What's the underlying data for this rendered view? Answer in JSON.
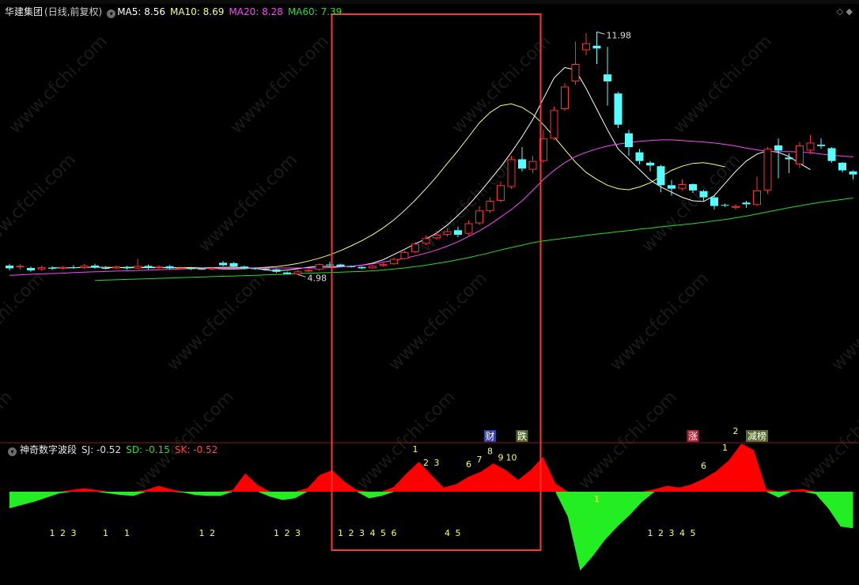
{
  "main": {
    "stock_name": "华建集团",
    "mode": "(日线,前复权)",
    "ma_labels": [
      {
        "text": "MA5: 8.56",
        "color": "#ffffff"
      },
      {
        "text": "MA10: 8.69",
        "color": "#ffff66"
      },
      {
        "text": "MA20: 8.28",
        "color": "#ff44ff"
      },
      {
        "text": "MA60: 7.39",
        "color": "#22dd22"
      }
    ],
    "high_label": "11.98",
    "low_label": "4.98",
    "event_tags": [
      {
        "text": "财",
        "bg": "#3340aa",
        "fg": "#ffffff"
      },
      {
        "text": "跌",
        "bg": "#556b2f",
        "fg": "#ffffff"
      },
      {
        "text": "涨",
        "bg": "#aa2233",
        "fg": "#ffffff"
      },
      {
        "text": "减榜",
        "bg": "#556b2f",
        "fg": "#ffffff"
      }
    ]
  },
  "sub": {
    "indicator_name": "神奇数字波段",
    "values": [
      {
        "text": "SJ: -0.52",
        "color": "#dddddd"
      },
      {
        "text": "SD: -0.15",
        "color": "#22dd22"
      },
      {
        "text": "SK: -0.52",
        "color": "#ff4444"
      }
    ]
  },
  "watermark": "www.cfchi.com",
  "colors": {
    "up": "#ff3030",
    "down": "#55ffff",
    "box": "#ff3333",
    "wave_pos": "#ff0000",
    "wave_neg": "#22ee22",
    "count": "#ffff44"
  },
  "chart_data": {
    "type": "candlestick",
    "title": "华建集团",
    "ylim": [
      4.6,
      12.3
    ],
    "candles": [
      {
        "o": 5.23,
        "c": 5.15,
        "h": 5.28,
        "l": 5.09
      },
      {
        "o": 5.18,
        "c": 5.22,
        "h": 5.27,
        "l": 5.12
      },
      {
        "o": 5.16,
        "c": 5.09,
        "h": 5.2,
        "l": 5.05
      },
      {
        "o": 5.12,
        "c": 5.18,
        "h": 5.22,
        "l": 5.08
      },
      {
        "o": 5.17,
        "c": 5.14,
        "h": 5.21,
        "l": 5.1
      },
      {
        "o": 5.14,
        "c": 5.19,
        "h": 5.22,
        "l": 5.11
      },
      {
        "o": 5.18,
        "c": 5.16,
        "h": 5.24,
        "l": 5.13
      },
      {
        "o": 5.16,
        "c": 5.23,
        "h": 5.27,
        "l": 5.13
      },
      {
        "o": 5.23,
        "c": 5.17,
        "h": 5.28,
        "l": 5.14
      },
      {
        "o": 5.16,
        "c": 5.15,
        "h": 5.21,
        "l": 5.12
      },
      {
        "o": 5.15,
        "c": 5.2,
        "h": 5.23,
        "l": 5.12
      },
      {
        "o": 5.19,
        "c": 5.15,
        "h": 5.22,
        "l": 5.11
      },
      {
        "o": 5.15,
        "c": 5.22,
        "h": 5.42,
        "l": 5.13
      },
      {
        "o": 5.22,
        "c": 5.16,
        "h": 5.26,
        "l": 5.12
      },
      {
        "o": 5.16,
        "c": 5.2,
        "h": 5.24,
        "l": 5.13
      },
      {
        "o": 5.21,
        "c": 5.15,
        "h": 5.24,
        "l": 5.12
      },
      {
        "o": 5.15,
        "c": 5.17,
        "h": 5.21,
        "l": 5.12
      },
      {
        "o": 5.16,
        "c": 5.13,
        "h": 5.19,
        "l": 5.1
      },
      {
        "o": 5.14,
        "c": 5.12,
        "h": 5.17,
        "l": 5.1
      },
      {
        "o": 5.12,
        "c": 5.16,
        "h": 5.19,
        "l": 5.1
      },
      {
        "o": 5.31,
        "c": 5.24,
        "h": 5.36,
        "l": 5.21
      },
      {
        "o": 5.3,
        "c": 5.2,
        "h": 5.33,
        "l": 5.18
      },
      {
        "o": 5.2,
        "c": 5.15,
        "h": 5.23,
        "l": 5.12
      },
      {
        "o": 5.15,
        "c": 5.13,
        "h": 5.18,
        "l": 5.11
      },
      {
        "o": 5.14,
        "c": 5.12,
        "h": 5.16,
        "l": 5.11
      },
      {
        "o": 5.12,
        "c": 5.05,
        "h": 5.14,
        "l": 5.02
      },
      {
        "o": 5.03,
        "c": 4.99,
        "h": 5.06,
        "l": 4.98
      },
      {
        "o": 4.98,
        "c": 5.06,
        "h": 5.1,
        "l": 4.97
      },
      {
        "o": 5.06,
        "c": 5.1,
        "h": 5.13,
        "l": 5.04
      },
      {
        "o": 5.11,
        "c": 5.27,
        "h": 5.29,
        "l": 5.08
      },
      {
        "o": 5.26,
        "c": 5.25,
        "h": 5.34,
        "l": 5.22
      },
      {
        "o": 5.26,
        "c": 5.21,
        "h": 5.28,
        "l": 5.19
      },
      {
        "o": 5.21,
        "c": 5.19,
        "h": 5.23,
        "l": 5.17
      },
      {
        "o": 5.19,
        "c": 5.15,
        "h": 5.21,
        "l": 5.13
      },
      {
        "o": 5.15,
        "c": 5.22,
        "h": 5.25,
        "l": 5.13
      },
      {
        "o": 5.22,
        "c": 5.27,
        "h": 5.3,
        "l": 5.2
      },
      {
        "o": 5.27,
        "c": 5.42,
        "h": 5.46,
        "l": 5.25
      },
      {
        "o": 5.42,
        "c": 5.62,
        "h": 5.66,
        "l": 5.4
      },
      {
        "o": 5.62,
        "c": 5.86,
        "h": 5.91,
        "l": 5.58
      },
      {
        "o": 5.86,
        "c": 6.02,
        "h": 6.1,
        "l": 5.82
      },
      {
        "o": 6.02,
        "c": 6.12,
        "h": 6.22,
        "l": 5.97
      },
      {
        "o": 6.12,
        "c": 6.22,
        "h": 6.3,
        "l": 6.07
      },
      {
        "o": 6.25,
        "c": 6.12,
        "h": 6.35,
        "l": 6.05
      },
      {
        "o": 6.15,
        "c": 6.45,
        "h": 6.53,
        "l": 6.1
      },
      {
        "o": 6.45,
        "c": 6.82,
        "h": 6.95,
        "l": 6.4
      },
      {
        "o": 6.8,
        "c": 7.1,
        "h": 7.2,
        "l": 6.75
      },
      {
        "o": 7.1,
        "c": 7.55,
        "h": 7.66,
        "l": 7.05
      },
      {
        "o": 7.5,
        "c": 8.3,
        "h": 8.4,
        "l": 7.45
      },
      {
        "o": 8.3,
        "c": 8.03,
        "h": 8.65,
        "l": 7.95
      },
      {
        "o": 8.0,
        "c": 8.25,
        "h": 8.4,
        "l": 7.9
      },
      {
        "o": 8.25,
        "c": 8.9,
        "h": 9.15,
        "l": 8.2
      },
      {
        "o": 8.9,
        "c": 9.72,
        "h": 9.82,
        "l": 8.85
      },
      {
        "o": 9.75,
        "c": 10.4,
        "h": 10.5,
        "l": 9.7
      },
      {
        "o": 10.55,
        "c": 11.05,
        "h": 11.7,
        "l": 10.45
      },
      {
        "o": 11.45,
        "c": 11.65,
        "h": 11.95,
        "l": 11.3
      },
      {
        "o": 11.58,
        "c": 11.5,
        "h": 11.98,
        "l": 11.05
      },
      {
        "o": 10.75,
        "c": 10.55,
        "h": 11.55,
        "l": 9.85
      },
      {
        "o": 10.2,
        "c": 9.3,
        "h": 10.25,
        "l": 9.2
      },
      {
        "o": 9.05,
        "c": 8.65,
        "h": 9.15,
        "l": 8.4
      },
      {
        "o": 8.5,
        "c": 8.25,
        "h": 8.6,
        "l": 8.15
      },
      {
        "o": 8.2,
        "c": 8.12,
        "h": 8.25,
        "l": 7.95
      },
      {
        "o": 8.1,
        "c": 7.55,
        "h": 8.14,
        "l": 7.35
      },
      {
        "o": 7.55,
        "c": 7.45,
        "h": 7.7,
        "l": 7.25
      },
      {
        "o": 7.45,
        "c": 7.58,
        "h": 7.72,
        "l": 7.4
      },
      {
        "o": 7.58,
        "c": 7.4,
        "h": 7.6,
        "l": 7.33
      },
      {
        "o": 7.38,
        "c": 7.2,
        "h": 7.42,
        "l": 7.1
      },
      {
        "o": 7.2,
        "c": 6.95,
        "h": 7.25,
        "l": 6.85
      },
      {
        "o": 6.98,
        "c": 6.97,
        "h": 7.02,
        "l": 6.92
      },
      {
        "o": 6.9,
        "c": 6.95,
        "h": 7.0,
        "l": 6.85
      },
      {
        "o": 7.05,
        "c": 7.0,
        "h": 7.1,
        "l": 6.9
      },
      {
        "o": 6.98,
        "c": 7.4,
        "h": 7.8,
        "l": 6.95
      },
      {
        "o": 7.4,
        "c": 8.6,
        "h": 8.65,
        "l": 7.3
      },
      {
        "o": 8.7,
        "c": 8.55,
        "h": 8.9,
        "l": 7.75
      },
      {
        "o": 8.35,
        "c": 8.3,
        "h": 8.48,
        "l": 7.9
      },
      {
        "o": 8.15,
        "c": 8.7,
        "h": 8.8,
        "l": 8.05
      },
      {
        "o": 8.55,
        "c": 8.78,
        "h": 9.0,
        "l": 8.45
      },
      {
        "o": 8.72,
        "c": 8.68,
        "h": 8.9,
        "l": 8.6
      },
      {
        "o": 8.62,
        "c": 8.25,
        "h": 8.65,
        "l": 8.2
      },
      {
        "o": 8.2,
        "c": 7.98,
        "h": 8.22,
        "l": 7.92
      },
      {
        "o": 7.95,
        "c": 7.86,
        "h": 7.98,
        "l": 7.72
      }
    ],
    "ma_series": [
      {
        "name": "MA5",
        "color": "#ffffff",
        "start": 4,
        "values": [
          5.17,
          5.16,
          5.17,
          5.18,
          5.18,
          5.18,
          5.17,
          5.18,
          5.18,
          5.18,
          5.18,
          5.17,
          5.17,
          5.17,
          5.16,
          5.17,
          5.18,
          5.18,
          5.17,
          5.15,
          5.1,
          5.08,
          5.1,
          5.14,
          5.18,
          5.21,
          5.2,
          5.2,
          5.21,
          5.24,
          5.3,
          5.4,
          5.55,
          5.7,
          5.86,
          6.0,
          6.17,
          6.4,
          6.68,
          6.98,
          7.33,
          7.7,
          8.08,
          8.5,
          8.95,
          9.45,
          10.05,
          10.65,
          10.95,
          10.88,
          10.35,
          9.75,
          9.15,
          8.6,
          8.3,
          8.0,
          7.7,
          7.5,
          7.35,
          7.2,
          7.1,
          7.08,
          7.25,
          7.6,
          7.95,
          8.25,
          8.45,
          8.55,
          8.5,
          8.38,
          8.18,
          8.0
        ]
      },
      {
        "name": "MA10",
        "color": "#ffff66",
        "start": 9,
        "values": [
          5.18,
          5.17,
          5.17,
          5.17,
          5.17,
          5.17,
          5.17,
          5.17,
          5.17,
          5.16,
          5.15,
          5.13,
          5.13,
          5.14,
          5.16,
          5.18,
          5.2,
          5.24,
          5.29,
          5.36,
          5.44,
          5.54,
          5.66,
          5.8,
          5.95,
          6.12,
          6.32,
          6.55,
          6.82,
          7.12,
          7.45,
          7.8,
          8.18,
          8.55,
          8.95,
          9.35,
          9.65,
          9.85,
          9.9,
          9.8,
          9.6,
          9.3,
          8.95,
          8.58,
          8.22,
          7.92,
          7.72,
          7.55,
          7.45,
          7.42,
          7.5,
          7.62,
          7.8,
          7.98,
          8.1,
          8.18,
          8.2,
          8.15,
          8.08
        ]
      },
      {
        "name": "MA20",
        "color": "#ff44ff",
        "start": 0,
        "values": [
          4.95,
          4.96,
          4.98,
          4.99,
          5.0,
          5.01,
          5.03,
          5.04,
          5.05,
          5.06,
          5.07,
          5.08,
          5.09,
          5.1,
          5.11,
          5.12,
          5.13,
          5.14,
          5.14,
          5.15,
          5.15,
          5.15,
          5.15,
          5.15,
          5.16,
          5.16,
          5.16,
          5.16,
          5.16,
          5.16,
          5.17,
          5.19,
          5.21,
          5.24,
          5.28,
          5.33,
          5.38,
          5.44,
          5.51,
          5.59,
          5.68,
          5.79,
          5.92,
          6.07,
          6.23,
          6.42,
          6.63,
          6.85,
          7.1,
          7.4,
          7.72,
          7.98,
          8.2,
          8.38,
          8.5,
          8.6,
          8.68,
          8.74,
          8.78,
          8.82,
          8.84,
          8.86,
          8.86,
          8.84,
          8.82,
          8.8,
          8.77,
          8.73,
          8.68,
          8.62,
          8.57,
          8.53,
          8.52,
          8.52,
          8.51,
          8.49,
          8.45,
          8.42,
          8.39,
          8.37
        ]
      },
      {
        "name": "MA60",
        "color": "#22dd22",
        "start": 8,
        "values": [
          4.8,
          4.81,
          4.82,
          4.83,
          4.84,
          4.85,
          4.86,
          4.87,
          4.88,
          4.89,
          4.9,
          4.91,
          4.92,
          4.93,
          4.94,
          4.95,
          4.96,
          4.97,
          4.98,
          5.0,
          5.01,
          5.02,
          5.03,
          5.04,
          5.05,
          5.06,
          5.08,
          5.1,
          5.13,
          5.16,
          5.2,
          5.24,
          5.29,
          5.34,
          5.4,
          5.46,
          5.53,
          5.6,
          5.68,
          5.75,
          5.82,
          5.89,
          5.94,
          5.98,
          6.02,
          6.06,
          6.1,
          6.14,
          6.17,
          6.21,
          6.24,
          6.28,
          6.31,
          6.35,
          6.38,
          6.41,
          6.44,
          6.48,
          6.52,
          6.56,
          6.61,
          6.66,
          6.72,
          6.78,
          6.84,
          6.9,
          6.96,
          7.01,
          7.06,
          7.1,
          7.14,
          7.18
        ]
      }
    ],
    "event_tag_bars": [
      45,
      48,
      64,
      70
    ],
    "highlight_bars": [
      31,
      49
    ],
    "oscillator": {
      "ylim": [
        -1.1,
        0.45
      ],
      "values": [
        -0.2,
        -0.16,
        -0.12,
        -0.07,
        -0.02,
        0.02,
        0.04,
        0.02,
        -0.02,
        -0.04,
        -0.05,
        0.02,
        0.07,
        0.03,
        -0.01,
        -0.04,
        -0.05,
        -0.05,
        0.02,
        0.22,
        0.08,
        -0.06,
        -0.1,
        -0.08,
        0.04,
        0.2,
        0.26,
        0.12,
        0.02,
        -0.08,
        -0.05,
        0.06,
        0.22,
        0.36,
        0.2,
        0.05,
        0.09,
        0.18,
        0.24,
        0.34,
        0.26,
        0.14,
        0.26,
        0.42,
        0.1,
        -0.3,
        -0.95,
        -0.78,
        -0.58,
        -0.42,
        -0.28,
        -0.12,
        0.03,
        0.07,
        0.05,
        0.09,
        0.16,
        0.25,
        0.38,
        0.58,
        0.5,
        0.03,
        -0.07,
        0.02,
        0.03,
        -0.03,
        -0.2,
        -0.42,
        -0.44
      ],
      "counts": [
        {
          "bar": 4,
          "t": "1"
        },
        {
          "bar": 5,
          "t": "2"
        },
        {
          "bar": 6,
          "t": "3"
        },
        {
          "bar": 9,
          "t": "1"
        },
        {
          "bar": 11,
          "t": "1"
        },
        {
          "bar": 18,
          "t": "1"
        },
        {
          "bar": 19,
          "t": "2"
        },
        {
          "bar": 25,
          "t": "1"
        },
        {
          "bar": 26,
          "t": "2"
        },
        {
          "bar": 27,
          "t": "3"
        },
        {
          "bar": 31,
          "t": "1"
        },
        {
          "bar": 32,
          "t": "2"
        },
        {
          "bar": 33,
          "t": "3"
        },
        {
          "bar": 34,
          "t": "4"
        },
        {
          "bar": 35,
          "t": "5"
        },
        {
          "bar": 36,
          "t": "6"
        },
        {
          "bar": 38,
          "t": "1"
        },
        {
          "bar": 39,
          "t": "2"
        },
        {
          "bar": 40,
          "t": "3"
        },
        {
          "bar": 41,
          "t": "4"
        },
        {
          "bar": 42,
          "t": "5"
        },
        {
          "bar": 43,
          "t": "6"
        },
        {
          "bar": 44,
          "t": "7"
        },
        {
          "bar": 45,
          "t": "8"
        },
        {
          "bar": 46,
          "t": "9"
        },
        {
          "bar": 47,
          "t": "10"
        },
        {
          "bar": 55,
          "t": "1"
        },
        {
          "bar": 60,
          "t": "1"
        },
        {
          "bar": 61,
          "t": "2"
        },
        {
          "bar": 62,
          "t": "3"
        },
        {
          "bar": 63,
          "t": "4"
        },
        {
          "bar": 64,
          "t": "5"
        },
        {
          "bar": 65,
          "t": "6"
        },
        {
          "bar": 67,
          "t": "1"
        },
        {
          "bar": 68,
          "t": "2"
        }
      ]
    }
  }
}
